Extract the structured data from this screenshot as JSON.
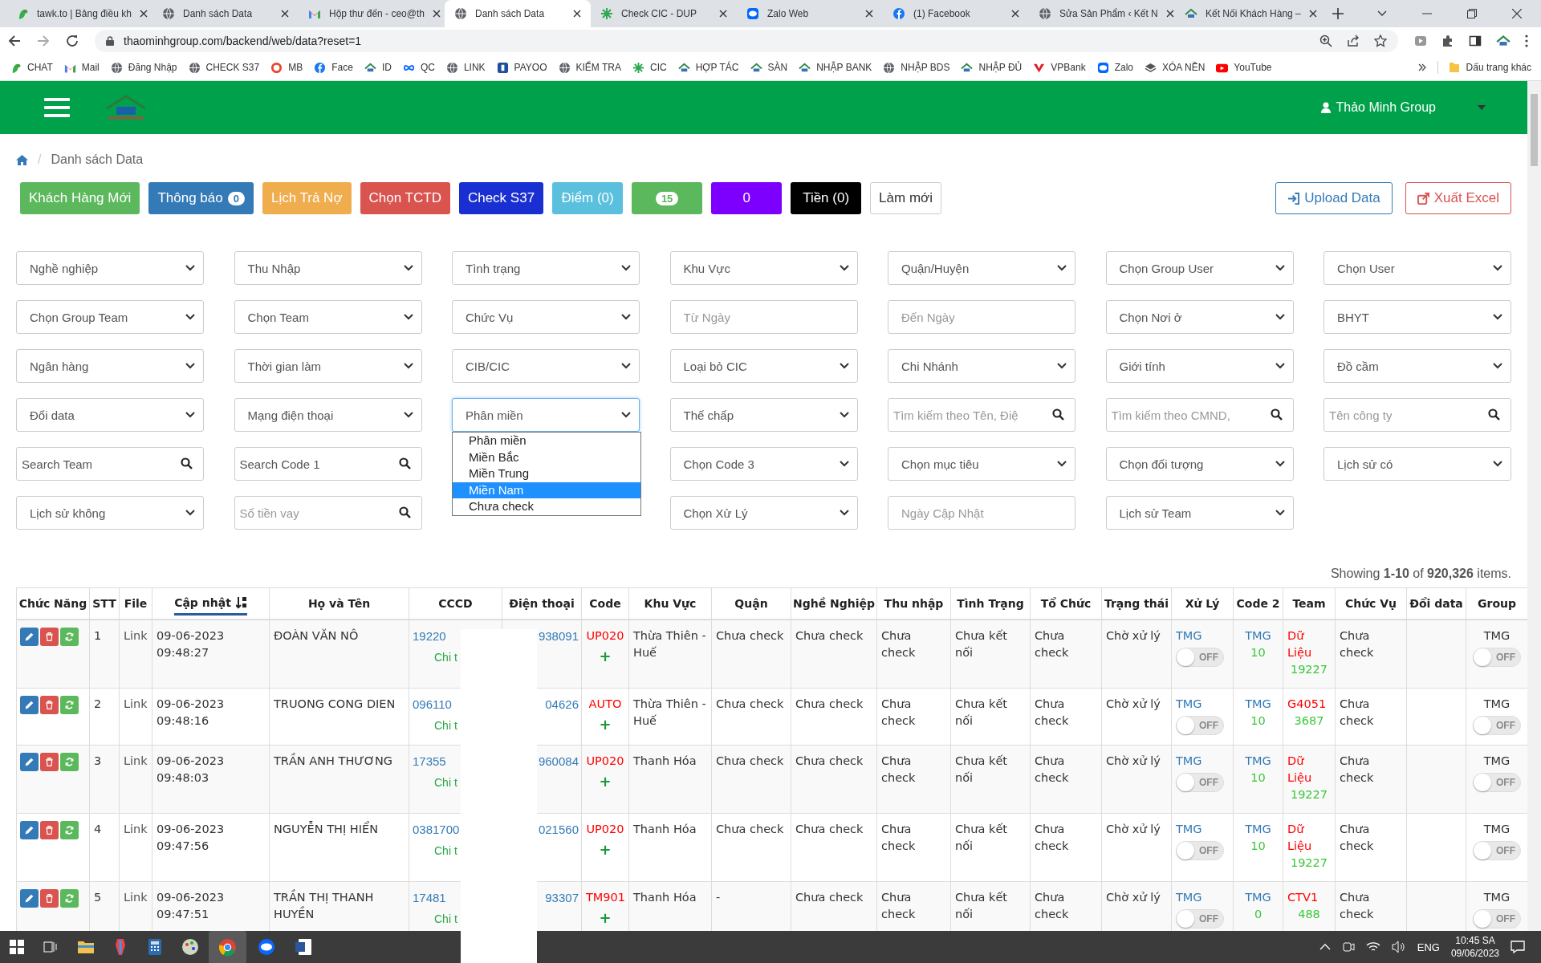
{
  "browser": {
    "tabs": [
      {
        "title": "tawk.to | Bảng điều kh",
        "kind": "bird",
        "selected": false
      },
      {
        "title": "Danh sách Data",
        "kind": "globe",
        "selected": false
      },
      {
        "title": "Hộp thư đến - ceo@th",
        "kind": "mail",
        "selected": false
      },
      {
        "title": "Danh sách Data",
        "kind": "globe",
        "selected": true
      },
      {
        "title": "Check CIC - DUP",
        "kind": "pinwheel",
        "selected": false
      },
      {
        "title": "Zalo Web",
        "kind": "chat",
        "selected": false
      },
      {
        "title": "(1) Facebook",
        "kind": "social",
        "selected": false
      },
      {
        "title": "Sửa Sản Phẩm ‹ Kết N",
        "kind": "globe",
        "selected": false
      },
      {
        "title": "Kết Nối Khách Hàng –",
        "kind": "house",
        "selected": false
      }
    ],
    "url": "thaominhgroup.com/backend/web/data?reset=1",
    "bookmarks": [
      {
        "label": "CHAT",
        "kind": "bird"
      },
      {
        "label": "Mail",
        "kind": "mail"
      },
      {
        "label": "Đăng Nhập",
        "kind": "globe"
      },
      {
        "label": "CHECK S37",
        "kind": "globe"
      },
      {
        "label": "MB",
        "kind": "ring"
      },
      {
        "label": "Face",
        "kind": "social"
      },
      {
        "label": "ID",
        "kind": "house"
      },
      {
        "label": "QC",
        "kind": "infinity"
      },
      {
        "label": "LINK",
        "kind": "globe"
      },
      {
        "label": "PAYOO",
        "kind": "square"
      },
      {
        "label": "KIỂM TRA",
        "kind": "globe"
      },
      {
        "label": "CIC",
        "kind": "pinwheel"
      },
      {
        "label": "HỢP TÁC",
        "kind": "house"
      },
      {
        "label": "SÀN",
        "kind": "house"
      },
      {
        "label": "NHẬP BANK",
        "kind": "house"
      },
      {
        "label": "NHẬP BDS",
        "kind": "globe"
      },
      {
        "label": "NHẬP ĐỦ",
        "kind": "house"
      },
      {
        "label": "VPBank",
        "kind": "chevron"
      },
      {
        "label": "Zalo",
        "kind": "chat"
      },
      {
        "label": "XÓA NỀN",
        "kind": "layers"
      },
      {
        "label": "YouTube",
        "kind": "play"
      }
    ],
    "other_bookmarks": "Dấu trang khác"
  },
  "header": {
    "user": "Thảo Minh Group"
  },
  "breadcrumb": {
    "separator": "/",
    "current": "Danh sách Data"
  },
  "buttons": [
    {
      "label": "Khách Hàng Mới",
      "kind": "solid",
      "color": "#5cb85c"
    },
    {
      "label": "Thông báo",
      "kind": "solid",
      "color": "#337ab7",
      "badge": "0"
    },
    {
      "label": "Lịch Trả Nợ",
      "kind": "solid",
      "color": "#f0ad4e"
    },
    {
      "label": "Chọn TCTD",
      "kind": "solid",
      "color": "#d9534f"
    },
    {
      "label": "Check S37",
      "kind": "solid",
      "color": "#1a2fd1"
    },
    {
      "label": "Điểm (0)",
      "kind": "solid",
      "color": "#5bc0de"
    },
    {
      "kind": "solid",
      "color": "#5cb85c",
      "badge": "15"
    },
    {
      "label": "0",
      "kind": "solid",
      "color": "#7d00ff"
    },
    {
      "label": "Tiền (0)",
      "kind": "solid",
      "color": "#000000"
    },
    {
      "label": "Làm mới",
      "kind": "outline",
      "color": "#333333"
    }
  ],
  "right_buttons": [
    {
      "label": "Upload Data",
      "kind": "upload",
      "color": "#337ab7"
    },
    {
      "label": "Xuất Excel",
      "kind": "export",
      "color": "#d9534f"
    }
  ],
  "filters": [
    [
      {
        "kind": "select",
        "label": "Nghề nghiệp"
      },
      {
        "kind": "select",
        "label": "Thu Nhập"
      },
      {
        "kind": "select",
        "label": "Tình trạng"
      },
      {
        "kind": "select",
        "label": "Khu Vực"
      },
      {
        "kind": "select",
        "label": "Quận/Huyện"
      },
      {
        "kind": "select",
        "label": "Chọn Group User"
      },
      {
        "kind": "select",
        "label": "Chọn User"
      }
    ],
    [
      {
        "kind": "select",
        "label": "Chọn Group Team"
      },
      {
        "kind": "select",
        "label": "Chọn Team"
      },
      {
        "kind": "select",
        "label": "Chức Vụ"
      },
      {
        "kind": "input",
        "placeholder": "Từ Ngày"
      },
      {
        "kind": "input",
        "placeholder": "Đến Ngày"
      },
      {
        "kind": "select",
        "label": "Chọn Nơi ở"
      },
      {
        "kind": "select",
        "label": "BHYT"
      }
    ],
    [
      {
        "kind": "select",
        "label": "Ngân hàng"
      },
      {
        "kind": "select",
        "label": "Thời gian làm"
      },
      {
        "kind": "select",
        "label": "CIB/CIC"
      },
      {
        "kind": "select",
        "label": "Loại bỏ CIC"
      },
      {
        "kind": "select",
        "label": "Chi Nhánh"
      },
      {
        "kind": "select",
        "label": "Giới tính"
      },
      {
        "kind": "select",
        "label": "Đồ cầm"
      }
    ],
    [
      {
        "kind": "select",
        "label": "Đổi data"
      },
      {
        "kind": "select",
        "label": "Mạng điện thoại"
      },
      {
        "kind": "select",
        "label": "Phân miền",
        "open": true,
        "options": [
          {
            "label": "Phân miền",
            "selected": false
          },
          {
            "label": "Miền Bắc",
            "selected": false
          },
          {
            "label": "Miền Trung",
            "selected": false
          },
          {
            "label": "Miền Nam",
            "selected": true
          },
          {
            "label": "Chưa check",
            "selected": false
          }
        ]
      },
      {
        "kind": "select",
        "label": "Thế chấp"
      },
      {
        "kind": "search",
        "placeholder": "Tìm kiếm theo Tên, Điệ"
      },
      {
        "kind": "search",
        "placeholder": "Tìm kiếm theo CMND,"
      },
      {
        "kind": "search",
        "placeholder": "Tên công ty"
      }
    ],
    [
      {
        "kind": "search",
        "value": "Search Team"
      },
      {
        "kind": "search",
        "value": "Search Code 1"
      },
      {
        "kind": "select",
        "label": "Chọn Code 3"
      },
      {
        "kind": "select",
        "label": "Chọn mục tiêu"
      },
      {
        "kind": "select",
        "label": "Chọn đối tượng"
      },
      {
        "kind": "select",
        "label": "Lịch sử có"
      }
    ],
    [
      {
        "kind": "select",
        "label": "Lịch sử không"
      },
      {
        "kind": "search",
        "placeholder": "Số tiền vay"
      },
      {
        "kind": "select",
        "label": "Chọn Xử Lý"
      },
      {
        "kind": "input",
        "placeholder": "Ngày Cập Nhật"
      },
      {
        "kind": "select",
        "label": "Lịch sử Team"
      }
    ]
  ],
  "summary": "Showing **1-10** of **920,326** items.",
  "table": {
    "columns": [
      {
        "label": "Chức Năng",
        "sorted": false
      },
      {
        "label": "STT",
        "sorted": false
      },
      {
        "label": "File",
        "sorted": false
      },
      {
        "label": "Cập nhật",
        "sorted": true
      },
      {
        "label": "Họ và Tên",
        "sorted": false
      },
      {
        "label": "CCCD",
        "sorted": false
      },
      {
        "label": "Điện thoại",
        "sorted": false
      },
      {
        "label": "Code",
        "sorted": false
      },
      {
        "label": "Khu Vực",
        "sorted": false
      },
      {
        "label": "Quận",
        "sorted": false
      },
      {
        "label": "Nghề Nghiệp",
        "sorted": false
      },
      {
        "label": "Thu nhập",
        "sorted": false
      },
      {
        "label": "Tình Trạng",
        "sorted": false
      },
      {
        "label": "Tổ Chức",
        "sorted": false
      },
      {
        "label": "Trạng thái",
        "sorted": false
      },
      {
        "label": "Xử Lý",
        "sorted": false
      },
      {
        "label": "Code 2",
        "sorted": false
      },
      {
        "label": "Team",
        "sorted": false
      },
      {
        "label": "Chức Vụ",
        "sorted": false
      },
      {
        "label": "Đổi data",
        "sorted": false
      },
      {
        "label": "Group",
        "sorted": false
      }
    ],
    "rows": [
      {
        "stt": "1",
        "file": "Link",
        "updated": "09-06-2023 09:48:27",
        "name": "ĐOÀN VĂN NÔ",
        "cccd": "19220",
        "cccd_detail": "Chi t",
        "phone": "938091",
        "code": "UP020",
        "code_add": "+",
        "area": "Thừa Thiên - Huế",
        "district": "Chưa check",
        "job": "Chưa check",
        "income": "Chưa check",
        "status": "Chưa kết nối",
        "org": "Chưa check",
        "state": "Chờ xử lý",
        "handler": "TMG",
        "handler_on": false,
        "handler_toggle": "OFF",
        "code2": "TMG",
        "code2_num": "10",
        "team": "Dữ Liệu",
        "team_num": "19227",
        "position": "Chưa check",
        "group": "TMG",
        "group_on": false,
        "group_toggle": "OFF"
      },
      {
        "stt": "2",
        "file": "Link",
        "updated": "09-06-2023 09:48:16",
        "name": "TRUONG CONG DIEN",
        "cccd": "096110",
        "cccd_detail": "Chi t",
        "phone": "04626",
        "code": "AUTO",
        "code_add": "+",
        "area": "Thừa Thiên - Huế",
        "district": "Chưa check",
        "job": "Chưa check",
        "income": "Chưa check",
        "status": "Chưa kết nối",
        "org": "Chưa check",
        "state": "Chờ xử lý",
        "handler": "TMG",
        "handler_on": false,
        "handler_toggle": "OFF",
        "code2": "TMG",
        "code2_num": "10",
        "team": "G4051",
        "team_num": "3687",
        "position": "Chưa check",
        "group": "TMG",
        "group_on": false,
        "group_toggle": "OFF"
      },
      {
        "stt": "3",
        "file": "Link",
        "updated": "09-06-2023 09:48:03",
        "name": "TRẦN ANH THƯƠNG",
        "cccd": "17355",
        "cccd_detail": "Chi t",
        "phone": "960084",
        "code": "UP020",
        "code_add": "+",
        "area": "Thanh Hóa",
        "district": "Chưa check",
        "job": "Chưa check",
        "income": "Chưa check",
        "status": "Chưa kết nối",
        "org": "Chưa check",
        "state": "Chờ xử lý",
        "handler": "TMG",
        "handler_on": false,
        "handler_toggle": "OFF",
        "code2": "TMG",
        "code2_num": "10",
        "team": "Dữ Liệu",
        "team_num": "19227",
        "position": "Chưa check",
        "group": "TMG",
        "group_on": false,
        "group_toggle": "OFF"
      },
      {
        "stt": "4",
        "file": "Link",
        "updated": "09-06-2023 09:47:56",
        "name": "NGUYỄN THỊ HIỂN",
        "cccd": "0381700",
        "cccd_detail": "Chi t",
        "phone": "021560",
        "code": "UP020",
        "code_add": "+",
        "area": "Thanh Hóa",
        "district": "Chưa check",
        "job": "Chưa check",
        "income": "Chưa check",
        "status": "Chưa kết nối",
        "org": "Chưa check",
        "state": "Chờ xử lý",
        "handler": "TMG",
        "handler_on": false,
        "handler_toggle": "OFF",
        "code2": "TMG",
        "code2_num": "10",
        "team": "Dữ Liệu",
        "team_num": "19227",
        "position": "Chưa check",
        "group": "TMG",
        "group_on": false,
        "group_toggle": "OFF"
      },
      {
        "stt": "5",
        "file": "Link",
        "updated": "09-06-2023 09:47:51",
        "name": "TRẦN THỊ THANH HUYỀN",
        "cccd": "17481",
        "cccd_detail": "Chi t",
        "phone": "93307",
        "code": "TM901",
        "code_add": "+",
        "area": "Thanh Hóa",
        "district": "-",
        "job": "Chưa check",
        "income": "Chưa check",
        "status": "Chưa kết nối",
        "org": "Chưa check",
        "state": "Chờ xử lý",
        "handler": "TMG",
        "handler_on": false,
        "handler_toggle": "OFF",
        "code2": "TMG",
        "code2_num": "0",
        "team": "CTV1",
        "team_num": "488",
        "position": "Chưa check",
        "group": "TMG",
        "group_on": false,
        "group_toggle": "OFF"
      }
    ]
  },
  "taskbar": {
    "language": "ENG",
    "time": "10:45 SA",
    "date": "09/06/2023"
  }
}
